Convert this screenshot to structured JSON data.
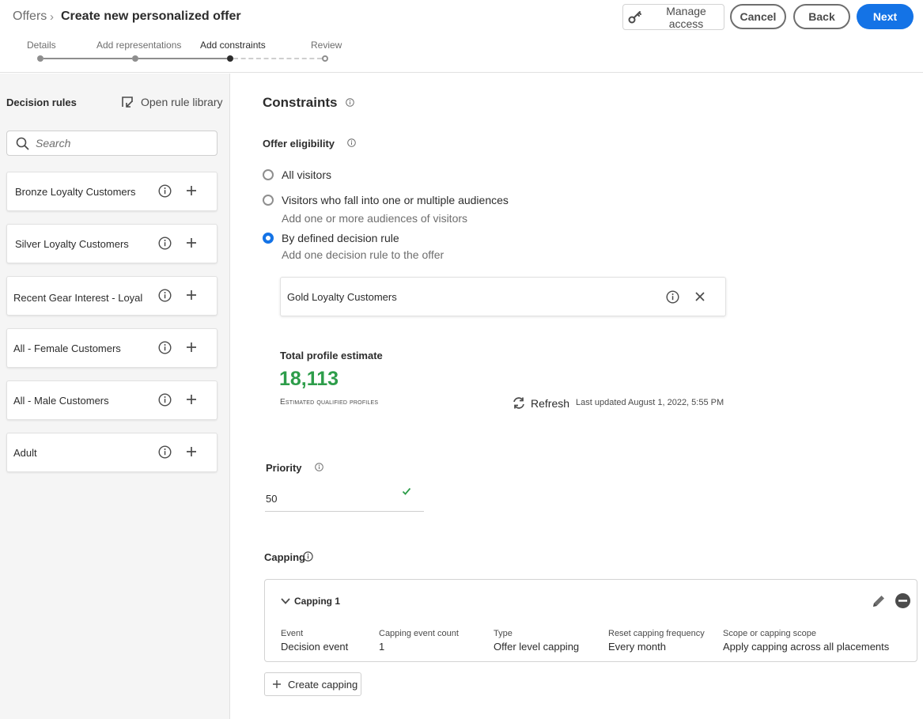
{
  "header": {
    "breadcrumb_root": "Offers",
    "breadcrumb_separator": "›",
    "title": "Create new personalized offer",
    "manage_access_label": "Manage access",
    "cancel_label": "Cancel",
    "back_label": "Back",
    "next_label": "Next"
  },
  "steps": [
    {
      "label": "Details",
      "state": "done"
    },
    {
      "label": "Add representations",
      "state": "done"
    },
    {
      "label": "Add constraints",
      "state": "current"
    },
    {
      "label": "Review",
      "state": "todo"
    }
  ],
  "left_panel": {
    "title": "Decision rules",
    "open_library_label": "Open rule library",
    "search_placeholder": "Search",
    "rules": [
      {
        "name": "Bronze Loyalty Customers"
      },
      {
        "name": "Silver Loyalty Customers"
      },
      {
        "name": "Recent Gear Interest - Loyal"
      },
      {
        "name": "All - Female Customers"
      },
      {
        "name": "All - Male Customers"
      },
      {
        "name": "Adult"
      }
    ]
  },
  "constraints": {
    "title": "Constraints",
    "eligibility_title": "Offer eligibility",
    "options": [
      {
        "label": "All visitors",
        "sub": "",
        "selected": false
      },
      {
        "label": "Visitors who fall into one or multiple audiences",
        "sub": "Add one or more audiences of visitors",
        "selected": false
      },
      {
        "label": "By defined decision rule",
        "sub": "Add one decision rule to the offer",
        "selected": true
      }
    ],
    "selected_rule": "Gold Loyalty Customers",
    "estimate": {
      "title": "Total profile estimate",
      "value": "18,113",
      "label": "Estimated qualified profiles",
      "refresh_label": "Refresh",
      "last_updated": "Last updated August 1, 2022, 5:55 PM"
    },
    "priority": {
      "label": "Priority",
      "value": "50"
    },
    "capping": {
      "label": "Capping",
      "items": [
        {
          "title": "Capping 1",
          "headers": [
            "Event",
            "Capping event count",
            "Type",
            "Reset capping frequency",
            "Scope or capping scope"
          ],
          "values": [
            "Decision event",
            "1",
            "Offer level capping",
            "Every month",
            "Apply capping across all placements"
          ]
        }
      ],
      "create_label": "Create capping"
    }
  },
  "colors": {
    "accent": "#1473e6",
    "success": "#2d9d4a",
    "panel_bg": "#f5f5f5"
  },
  "icons": {
    "manage_access": "key-icon",
    "open_library": "open-in-icon",
    "search": "search-icon",
    "info": "info-icon",
    "add": "add-icon",
    "remove": "close-icon",
    "refresh": "refresh-icon",
    "check": "checkmark-icon",
    "edit": "pencil-icon",
    "delete": "remove-circle-icon",
    "collapse": "chevron-down-icon"
  }
}
